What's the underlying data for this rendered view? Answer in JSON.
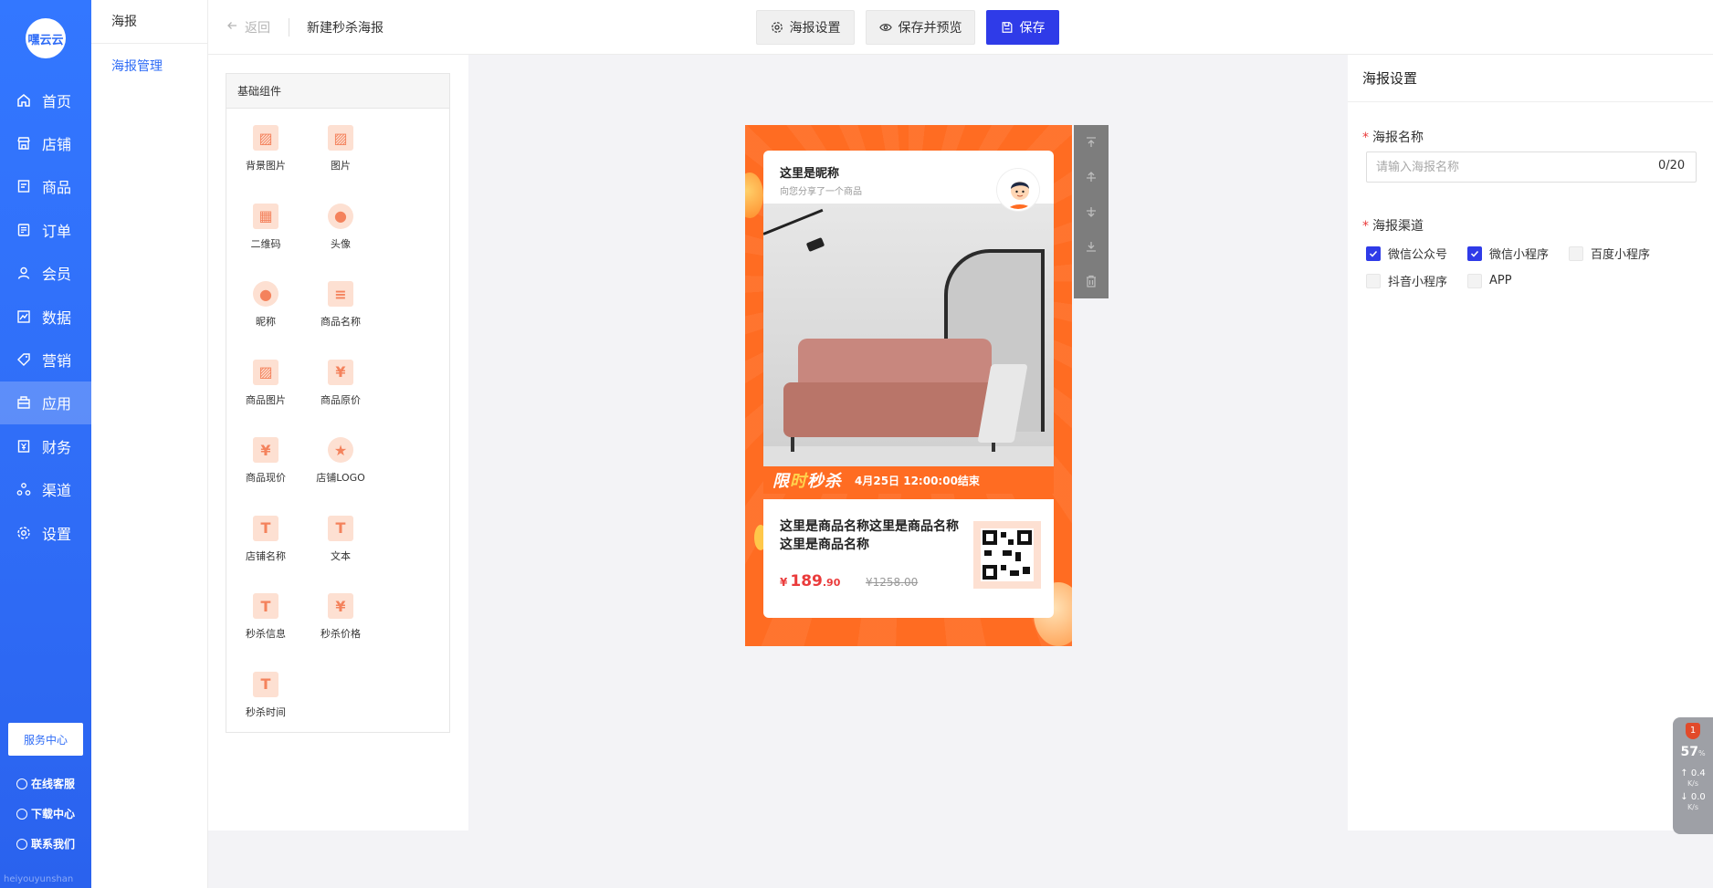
{
  "brand": {
    "logo_text": "嘿云云",
    "footer": "heiyouyunshan",
    "accent": "#2f6cf6",
    "primary_button": "#2f3be8",
    "poster_bg": "#ff6c22"
  },
  "sidebar": {
    "items": [
      {
        "label": "首页",
        "icon": "home-icon"
      },
      {
        "label": "店铺",
        "icon": "store-icon"
      },
      {
        "label": "商品",
        "icon": "goods-icon"
      },
      {
        "label": "订单",
        "icon": "order-icon"
      },
      {
        "label": "会员",
        "icon": "user-icon"
      },
      {
        "label": "数据",
        "icon": "chart-icon"
      },
      {
        "label": "营销",
        "icon": "tag-icon"
      },
      {
        "label": "应用",
        "icon": "app-icon",
        "active": true
      },
      {
        "label": "财务",
        "icon": "finance-icon"
      },
      {
        "label": "渠道",
        "icon": "channel-icon"
      },
      {
        "label": "设置",
        "icon": "gear-icon"
      }
    ],
    "service_center": "服务中心",
    "links": [
      "在线客服",
      "下载中心",
      "联系我们"
    ]
  },
  "subnav": {
    "title": "海报",
    "items": [
      "海报管理"
    ]
  },
  "header": {
    "back": "返回",
    "title": "新建秒杀海报",
    "buttons": {
      "settings": "海报设置",
      "save_preview": "保存并预览",
      "save": "保存"
    }
  },
  "components": {
    "title": "基础组件",
    "items": [
      {
        "label": "背景图片",
        "glyph": "▨"
      },
      {
        "label": "图片",
        "glyph": "▨"
      },
      {
        "label": "二维码",
        "glyph": "▦"
      },
      {
        "label": "头像",
        "glyph": "●"
      },
      {
        "label": "昵称",
        "glyph": "●"
      },
      {
        "label": "商品名称",
        "glyph": "≡"
      },
      {
        "label": "商品图片",
        "glyph": "▨"
      },
      {
        "label": "商品原价",
        "glyph": "¥"
      },
      {
        "label": "商品现价",
        "glyph": "¥"
      },
      {
        "label": "店铺LOGO",
        "glyph": "★"
      },
      {
        "label": "店铺名称",
        "glyph": "T"
      },
      {
        "label": "文本",
        "glyph": "T"
      },
      {
        "label": "秒杀信息",
        "glyph": "T"
      },
      {
        "label": "秒杀价格",
        "glyph": "¥"
      },
      {
        "label": "秒杀时间",
        "glyph": "T"
      }
    ]
  },
  "poster": {
    "nickname": "这里是昵称",
    "share_text": "向您分享了一个商品",
    "flash_title_1": "限",
    "flash_title_2": "时",
    "flash_title_3": "秒杀",
    "flash_time": "4月25日 12:00:00结束",
    "goods_name": "这里是商品名称这里是商品名称这里是商品名称",
    "price_currency": "¥",
    "price_int": "189",
    "price_dec": ".90",
    "original_price": "¥1258.00"
  },
  "tools": [
    "move-top-icon",
    "move-up-icon",
    "move-down-icon",
    "move-bottom-icon",
    "delete-icon"
  ],
  "settings": {
    "title": "海报设置",
    "name_label": "海报名称",
    "name_placeholder": "请输入海报名称",
    "name_counter": "0/20",
    "channel_label": "海报渠道",
    "channels": [
      {
        "label": "微信公众号",
        "checked": true
      },
      {
        "label": "微信小程序",
        "checked": true
      },
      {
        "label": "百度小程序",
        "checked": false
      },
      {
        "label": "抖音小程序",
        "checked": false
      },
      {
        "label": "APP",
        "checked": false
      }
    ]
  },
  "speed_widget": {
    "badge": "1",
    "percent": "57",
    "percent_unit": "%",
    "up": "0.4",
    "down": "0.0",
    "unit": "K/s"
  }
}
